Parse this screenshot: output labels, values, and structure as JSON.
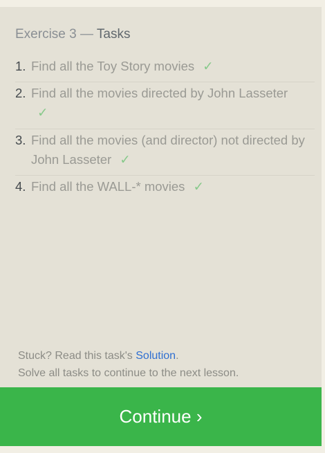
{
  "header": {
    "exercise": "Exercise 3",
    "separator": " — ",
    "tasks_label": "Tasks"
  },
  "tasks": [
    {
      "number": "1.",
      "text": "Find all the Toy Story movies",
      "check": "✓"
    },
    {
      "number": "2.",
      "text": "Find all the movies directed by John Lasseter",
      "check": "✓"
    },
    {
      "number": "3.",
      "text": "Find all the movies (and director) not directed by John Lasseter",
      "check": "✓"
    },
    {
      "number": "4.",
      "text": "Find all the WALL-* movies",
      "check": "✓"
    }
  ],
  "footer": {
    "stuck_prefix": "Stuck? Read this task's ",
    "solution_link": "Solution",
    "stuck_suffix": ".",
    "instruction": "Solve all tasks to continue to the next lesson."
  },
  "continue_button": {
    "label": "Continue ›"
  },
  "colors": {
    "panel_background": "#e4e1d6",
    "check": "#86c98a",
    "link": "#2f6fd1",
    "continue_background": "#3ab54a"
  }
}
